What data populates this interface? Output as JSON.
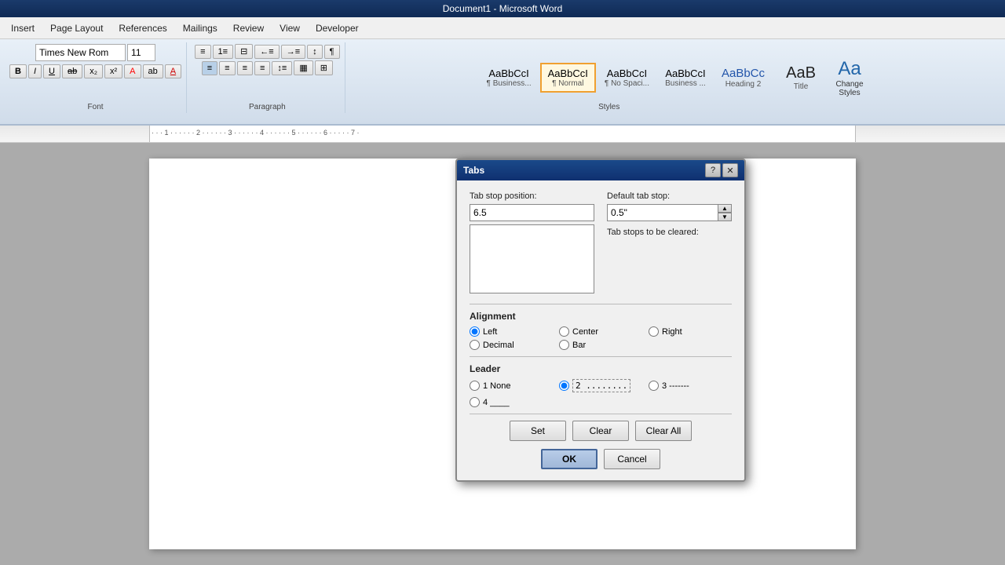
{
  "titlebar": {
    "title": "Document1 - Microsoft Word"
  },
  "menubar": {
    "items": [
      "Insert",
      "Page Layout",
      "References",
      "Mailings",
      "Review",
      "View",
      "Developer"
    ]
  },
  "ribbon": {
    "font_name": "Times New Rom",
    "font_size": "11",
    "styles_label": "Styles",
    "font_label": "Font",
    "paragraph_label": "Paragraph",
    "style_items": [
      {
        "id": "business1",
        "label": "¶ Business...",
        "preview": "AaBbCcI"
      },
      {
        "id": "normal",
        "label": "¶ Normal",
        "preview": "AaBbCcI",
        "selected": true
      },
      {
        "id": "no-spacing",
        "label": "¶ No Spaci...",
        "preview": "AaBbCcI"
      },
      {
        "id": "business2",
        "label": "Business ...",
        "preview": "AaBbCcI"
      },
      {
        "id": "heading2",
        "label": "Heading 2",
        "preview": "AaBbCc"
      },
      {
        "id": "title",
        "label": "Title",
        "preview": "AaB"
      }
    ],
    "change_styles_label": "Change\nStyles"
  },
  "dialog": {
    "title": "Tabs",
    "tab_stop_position_label": "Tab stop position:",
    "tab_stop_position_value": "6.5",
    "default_tab_stop_label": "Default tab stop:",
    "default_tab_stop_value": "0.5\"",
    "tab_stops_cleared_label": "Tab stops to be cleared:",
    "alignment_label": "Alignment",
    "alignment_options": [
      {
        "id": "left",
        "label": "Left",
        "checked": true
      },
      {
        "id": "center",
        "label": "Center",
        "checked": false
      },
      {
        "id": "right",
        "label": "Right",
        "checked": false
      },
      {
        "id": "decimal",
        "label": "Decimal",
        "checked": false
      },
      {
        "id": "bar",
        "label": "Bar",
        "checked": false
      }
    ],
    "leader_label": "Leader",
    "leader_options": [
      {
        "id": "none",
        "label": "1 None",
        "checked": false
      },
      {
        "id": "dots",
        "label": "2 ........",
        "checked": true
      },
      {
        "id": "dashes",
        "label": "3 -------",
        "checked": false
      },
      {
        "id": "underline",
        "label": "4 ____",
        "checked": false
      }
    ],
    "btn_set": "Set",
    "btn_clear": "Clear",
    "btn_clear_all": "Clear All",
    "btn_ok": "OK",
    "btn_cancel": "Cancel"
  }
}
